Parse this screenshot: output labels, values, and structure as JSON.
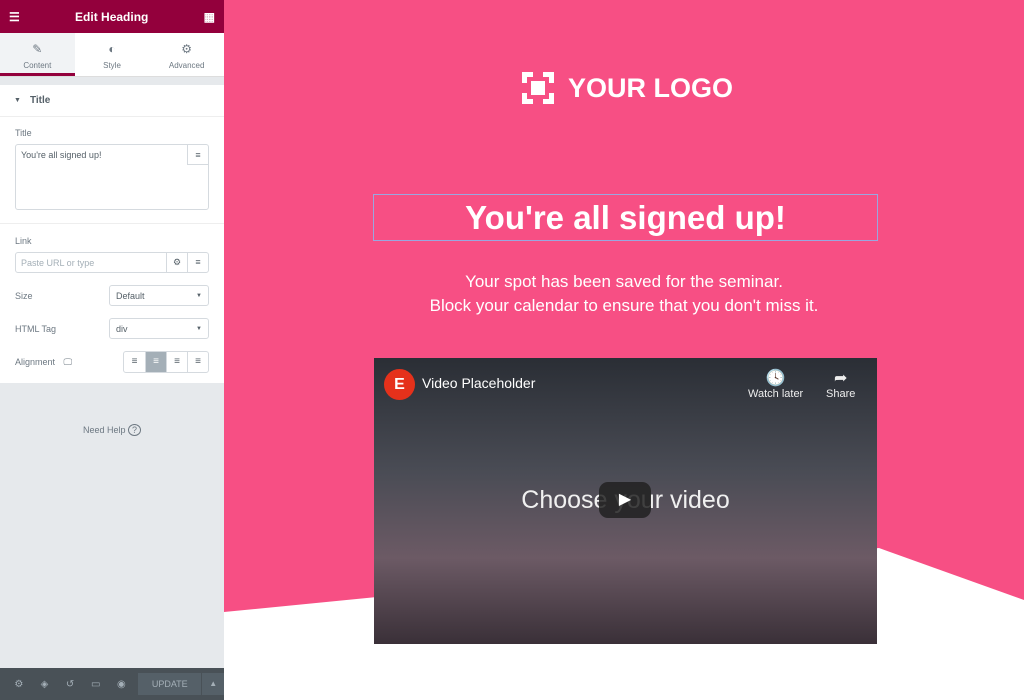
{
  "panel": {
    "title": "Edit Heading",
    "tabs": [
      {
        "label": "Content",
        "icon": "pencil-icon"
      },
      {
        "label": "Style",
        "icon": "contrast-icon"
      },
      {
        "label": "Advanced",
        "icon": "gear-icon"
      }
    ],
    "section": "Title",
    "title_label": "Title",
    "title_value": "You're all signed up!",
    "link_label": "Link",
    "link_placeholder": "Paste URL or type",
    "size_label": "Size",
    "size_value": "Default",
    "tag_label": "HTML Tag",
    "tag_value": "div",
    "alignment_label": "Alignment",
    "alignment_selected": "center",
    "help": "Need Help",
    "update": "UPDATE"
  },
  "page": {
    "logo": "YOUR LOGO",
    "heading": "You're all signed up!",
    "sub1": "Your spot has been saved for the seminar.",
    "sub2": "Block your calendar to ensure that you don't miss it.",
    "video": {
      "title": "Video Placeholder",
      "watch_later": "Watch later",
      "share": "Share",
      "overlay": "Choose your video"
    }
  },
  "colors": {
    "brand": "#93003c",
    "background": "#f74f84"
  }
}
